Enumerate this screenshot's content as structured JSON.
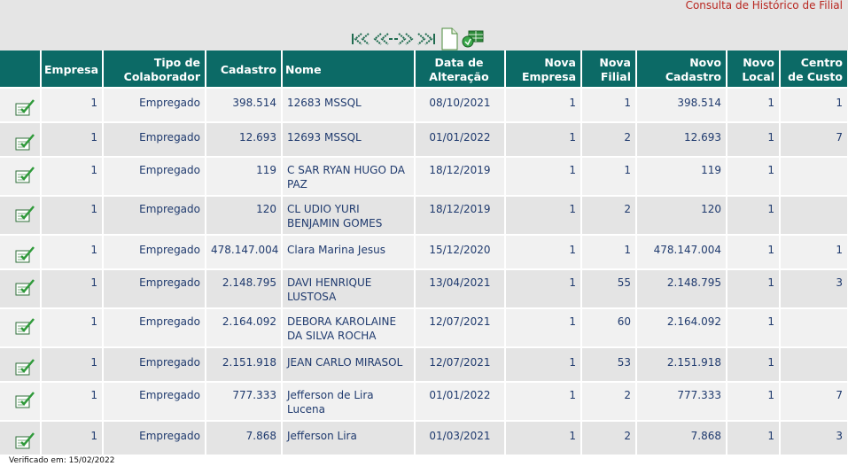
{
  "page": {
    "title": "Consulta de Histórico de Filial",
    "footer": "Verificado em: 15/02/2022"
  },
  "toolbar": {
    "icons": [
      "first-page-icon",
      "previous-page-icon",
      "next-page-icon",
      "last-page-icon",
      "document-icon",
      "excel-export-icon"
    ]
  },
  "colors": {
    "header_bg": "#0c6a66",
    "title_red": "#b8261f",
    "cell_text": "#1f3a6e",
    "row_odd": "#f1f1f1",
    "row_even": "#e4e4e4"
  },
  "table": {
    "headers": {
      "empresa": "Empresa",
      "tipo": "Tipo de Colaborador",
      "cadastro": "Cadastro",
      "nome": "Nome",
      "data": "Data de Alteração",
      "nova_empresa": "Nova Empresa",
      "nova_filial": "Nova Filial",
      "novo_cadastro": "Novo Cadastro",
      "novo_local": "Novo Local",
      "centro_custo": "Centro de Custo"
    },
    "rows": [
      {
        "empresa": "1",
        "tipo": "Empregado",
        "cadastro": "398.514",
        "nome": "12683 MSSQL",
        "data": "08/10/2021",
        "nova_empresa": "1",
        "nova_filial": "1",
        "novo_cadastro": "398.514",
        "novo_local": "1",
        "centro_custo": "1"
      },
      {
        "empresa": "1",
        "tipo": "Empregado",
        "cadastro": "12.693",
        "nome": "12693 MSSQL",
        "data": "01/01/2022",
        "nova_empresa": "1",
        "nova_filial": "2",
        "novo_cadastro": "12.693",
        "novo_local": "1",
        "centro_custo": "7"
      },
      {
        "empresa": "1",
        "tipo": "Empregado",
        "cadastro": "119",
        "nome": "C SAR RYAN HUGO DA PAZ",
        "data": "18/12/2019",
        "nova_empresa": "1",
        "nova_filial": "1",
        "novo_cadastro": "119",
        "novo_local": "1",
        "centro_custo": ""
      },
      {
        "empresa": "1",
        "tipo": "Empregado",
        "cadastro": "120",
        "nome": "CL UDIO YURI BENJAMIN GOMES",
        "data": "18/12/2019",
        "nova_empresa": "1",
        "nova_filial": "2",
        "novo_cadastro": "120",
        "novo_local": "1",
        "centro_custo": ""
      },
      {
        "empresa": "1",
        "tipo": "Empregado",
        "cadastro": "478.147.004",
        "nome": "Clara Marina Jesus",
        "data": "15/12/2020",
        "nova_empresa": "1",
        "nova_filial": "1",
        "novo_cadastro": "478.147.004",
        "novo_local": "1",
        "centro_custo": "1"
      },
      {
        "empresa": "1",
        "tipo": "Empregado",
        "cadastro": "2.148.795",
        "nome": "DAVI HENRIQUE LUSTOSA",
        "data": "13/04/2021",
        "nova_empresa": "1",
        "nova_filial": "55",
        "novo_cadastro": "2.148.795",
        "novo_local": "1",
        "centro_custo": "3"
      },
      {
        "empresa": "1",
        "tipo": "Empregado",
        "cadastro": "2.164.092",
        "nome": "DEBORA KAROLAINE DA SILVA ROCHA",
        "data": "12/07/2021",
        "nova_empresa": "1",
        "nova_filial": "60",
        "novo_cadastro": "2.164.092",
        "novo_local": "1",
        "centro_custo": ""
      },
      {
        "empresa": "1",
        "tipo": "Empregado",
        "cadastro": "2.151.918",
        "nome": "JEAN CARLO MIRASOL",
        "data": "12/07/2021",
        "nova_empresa": "1",
        "nova_filial": "53",
        "novo_cadastro": "2.151.918",
        "novo_local": "1",
        "centro_custo": ""
      },
      {
        "empresa": "1",
        "tipo": "Empregado",
        "cadastro": "777.333",
        "nome": "Jefferson de Lira Lucena",
        "data": "01/01/2022",
        "nova_empresa": "1",
        "nova_filial": "2",
        "novo_cadastro": "777.333",
        "novo_local": "1",
        "centro_custo": "7"
      },
      {
        "empresa": "1",
        "tipo": "Empregado",
        "cadastro": "7.868",
        "nome": "Jefferson Lira",
        "data": "01/03/2021",
        "nova_empresa": "1",
        "nova_filial": "2",
        "novo_cadastro": "7.868",
        "novo_local": "1",
        "centro_custo": "3"
      }
    ]
  }
}
